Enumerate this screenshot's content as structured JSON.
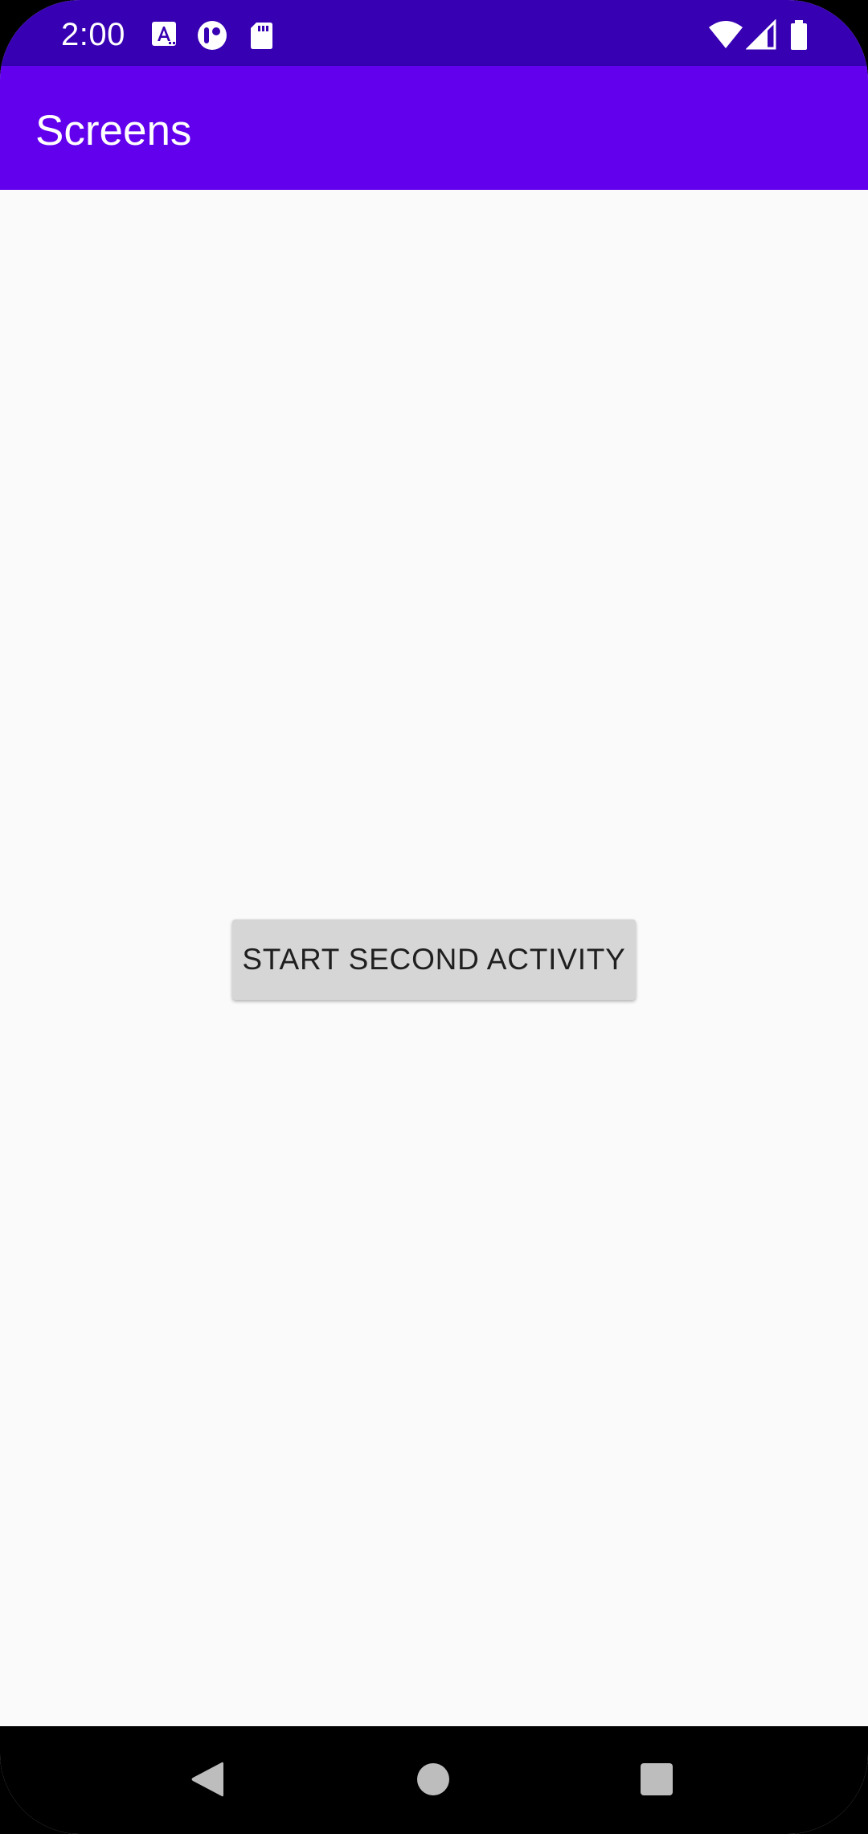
{
  "status_bar": {
    "time": "2:00",
    "left_icons": [
      "font-icon",
      "circle-app-icon",
      "sd-card-icon"
    ],
    "right_icons": [
      "wifi-icon",
      "cell-signal-icon",
      "battery-icon"
    ],
    "background_color": "#3700b3"
  },
  "app_bar": {
    "title": "Screens",
    "background_color": "#6200ee"
  },
  "main": {
    "button_label": "START SECOND ACTIVITY"
  },
  "nav_bar": {
    "icons": [
      "back-icon",
      "home-icon",
      "recents-icon"
    ]
  }
}
